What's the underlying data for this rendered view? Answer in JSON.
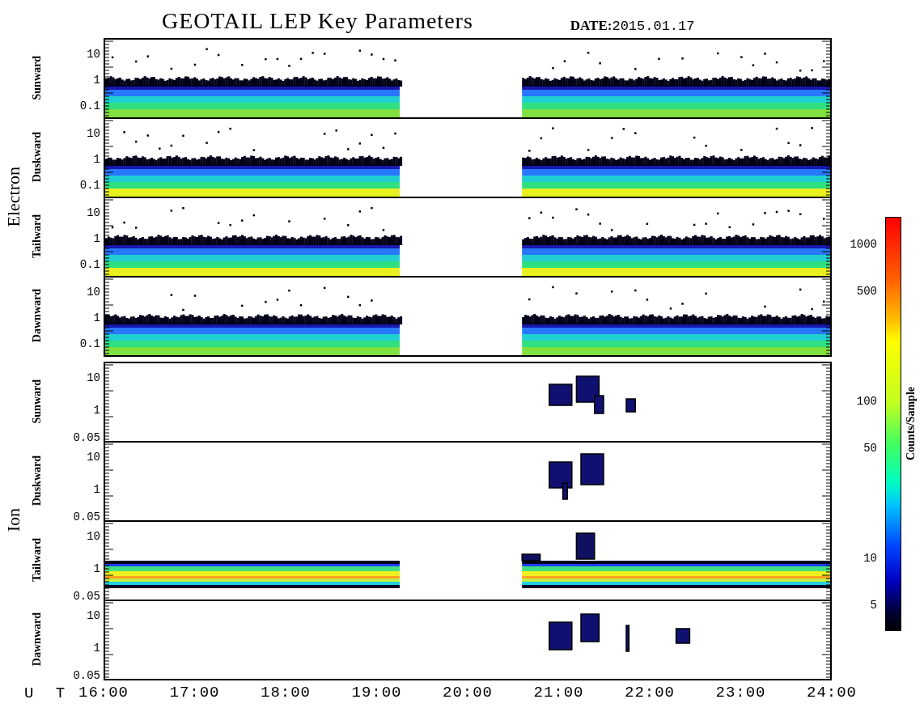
{
  "title": "GEOTAIL LEP Key Parameters",
  "date_label": "DATE:",
  "date": "2015.01.17",
  "groups": [
    {
      "name": "Electron",
      "kind": "electron",
      "panels": [
        {
          "direction": "Sunward",
          "yticks": [
            "10",
            "1",
            "0.1"
          ]
        },
        {
          "direction": "Duskward",
          "yticks": [
            "10",
            "1",
            "0.1"
          ]
        },
        {
          "direction": "Tailward",
          "yticks": [
            "10",
            "1",
            "0.1"
          ]
        },
        {
          "direction": "Dawnward",
          "yticks": [
            "10",
            "1",
            "0.1"
          ]
        }
      ]
    },
    {
      "name": "Ion",
      "kind": "ion",
      "panels": [
        {
          "direction": "Sunward",
          "kind": "patches",
          "yticks": [
            "10",
            "1",
            "0.05"
          ]
        },
        {
          "direction": "Duskward",
          "kind": "patches",
          "yticks": [
            "10",
            "1",
            "0.05"
          ]
        },
        {
          "direction": "Tailward",
          "kind": "band",
          "yticks": [
            "10",
            "1",
            "0.05"
          ]
        },
        {
          "direction": "Dawnward",
          "kind": "patches",
          "yticks": [
            "10",
            "1",
            "0.05"
          ]
        }
      ]
    }
  ],
  "x_axis": {
    "label": "U T",
    "ticks": [
      "16:00",
      "17:00",
      "18:00",
      "19:00",
      "20:00",
      "21:00",
      "22:00",
      "23:00",
      "24:00"
    ]
  },
  "colorbar": {
    "label": "Counts/Sample",
    "ticks": [
      "1000",
      "500",
      "100",
      "50",
      "10",
      "5"
    ]
  }
}
